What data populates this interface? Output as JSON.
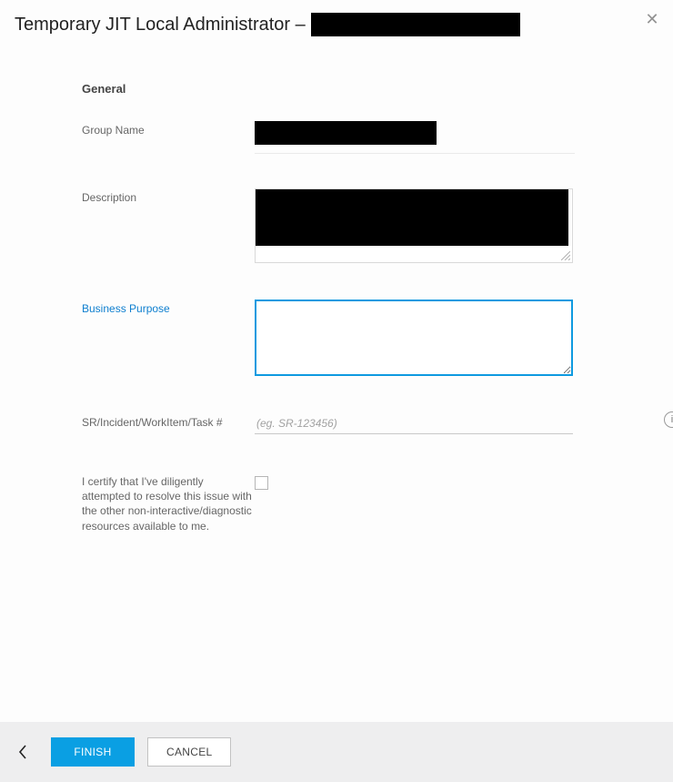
{
  "header": {
    "title_prefix": "Temporary JIT Local Administrator –"
  },
  "section": {
    "heading": "General"
  },
  "labels": {
    "group_name": "Group Name",
    "description": "Description",
    "business_purpose": "Business Purpose",
    "ticket": "SR/Incident/WorkItem/Task #",
    "certify": "I certify that I've diligently attempted to resolve this issue with the other non-interactive/diagnostic resources available to me."
  },
  "inputs": {
    "business_purpose_value": "",
    "ticket_placeholder": "(eg. SR-123456)",
    "ticket_value": "",
    "certify_checked": false
  },
  "footer": {
    "finish": "FINISH",
    "cancel": "CANCEL"
  },
  "icons": {
    "close": "close-icon",
    "info": "info-icon",
    "back": "chevron-left-icon"
  }
}
